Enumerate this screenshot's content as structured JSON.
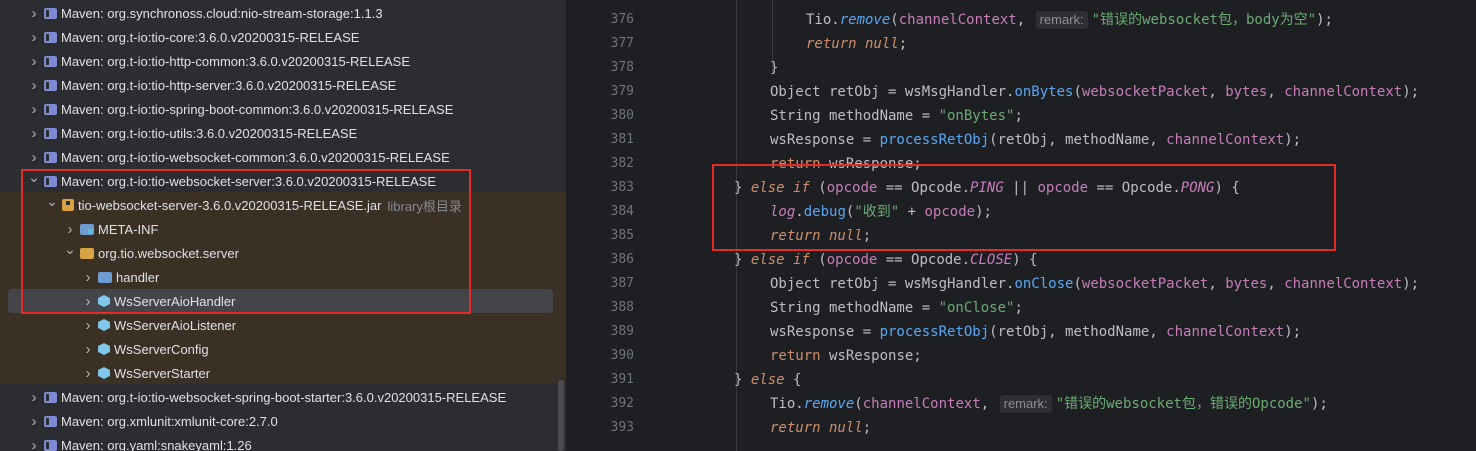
{
  "project_tree": {
    "items": [
      {
        "label": "Maven: org.synchronoss.cloud:nio-stream-storage:1.1.3",
        "level": 0,
        "type": "library",
        "expanded": false
      },
      {
        "label": "Maven: org.t-io:tio-core:3.6.0.v20200315-RELEASE",
        "level": 0,
        "type": "library",
        "expanded": false
      },
      {
        "label": "Maven: org.t-io:tio-http-common:3.6.0.v20200315-RELEASE",
        "level": 0,
        "type": "library",
        "expanded": false
      },
      {
        "label": "Maven: org.t-io:tio-http-server:3.6.0.v20200315-RELEASE",
        "level": 0,
        "type": "library",
        "expanded": false
      },
      {
        "label": "Maven: org.t-io:tio-spring-boot-common:3.6.0.v20200315-RELEASE",
        "level": 0,
        "type": "library",
        "expanded": false
      },
      {
        "label": "Maven: org.t-io:tio-utils:3.6.0.v20200315-RELEASE",
        "level": 0,
        "type": "library",
        "expanded": false
      },
      {
        "label": "Maven: org.t-io:tio-websocket-common:3.6.0.v20200315-RELEASE",
        "level": 0,
        "type": "library",
        "expanded": false
      },
      {
        "label": "Maven: org.t-io:tio-websocket-server:3.6.0.v20200315-RELEASE",
        "level": 0,
        "type": "library",
        "expanded": true
      },
      {
        "label": "tio-websocket-server-3.6.0.v20200315-RELEASE.jar",
        "suffix": "library根目录",
        "level": 1,
        "type": "jar",
        "expanded": true
      },
      {
        "label": "META-INF",
        "level": 2,
        "type": "folder-meta",
        "expanded": false
      },
      {
        "label": "org.tio.websocket.server",
        "level": 2,
        "type": "package",
        "expanded": true
      },
      {
        "label": "handler",
        "level": 3,
        "type": "folder",
        "expanded": false
      },
      {
        "label": "WsServerAioHandler",
        "level": 3,
        "type": "class",
        "expanded": false,
        "selected": true
      },
      {
        "label": "WsServerAioListener",
        "level": 3,
        "type": "class",
        "expanded": false
      },
      {
        "label": "WsServerConfig",
        "level": 3,
        "type": "class",
        "expanded": false
      },
      {
        "label": "WsServerStarter",
        "level": 3,
        "type": "class",
        "expanded": false
      },
      {
        "label": "Maven: org.t-io:tio-websocket-spring-boot-starter:3.6.0.v20200315-RELEASE",
        "level": 0,
        "type": "library",
        "expanded": false
      },
      {
        "label": "Maven: org.xmlunit:xmlunit-core:2.7.0",
        "level": 0,
        "type": "library",
        "expanded": false
      },
      {
        "label": "Maven: org.yaml:snakeyaml:1.26",
        "level": 0,
        "type": "library",
        "expanded": false
      }
    ]
  },
  "editor": {
    "lines": [
      {
        "n": "376",
        "tokens": [
          [
            "typ",
            "Tio."
          ],
          [
            "fni",
            "remove"
          ],
          [
            "typ",
            "("
          ],
          [
            "fld",
            "channelContext"
          ],
          [
            "typ",
            ", "
          ],
          [
            "hint",
            "remark:"
          ],
          [
            "str",
            "\"错误的websocket包，body为空\""
          ],
          [
            "typ",
            ");"
          ]
        ],
        "indent": 3
      },
      {
        "n": "377",
        "tokens": [
          [
            "kwi",
            "return null"
          ],
          [
            "typ",
            ";"
          ]
        ],
        "indent": 3
      },
      {
        "n": "378",
        "tokens": [
          [
            "typ",
            "}"
          ]
        ],
        "indent": 2
      },
      {
        "n": "379",
        "tokens": [
          [
            "typ",
            "Object retObj = wsMsgHandler."
          ],
          [
            "fn",
            "onBytes"
          ],
          [
            "typ",
            "("
          ],
          [
            "fld",
            "websocketPacket"
          ],
          [
            "typ",
            ", "
          ],
          [
            "fld",
            "bytes"
          ],
          [
            "typ",
            ", "
          ],
          [
            "fld",
            "channelContext"
          ],
          [
            "typ",
            ");"
          ]
        ],
        "indent": 2
      },
      {
        "n": "380",
        "tokens": [
          [
            "typ",
            "String methodName = "
          ],
          [
            "str",
            "\"onBytes\""
          ],
          [
            "typ",
            ";"
          ]
        ],
        "indent": 2
      },
      {
        "n": "381",
        "tokens": [
          [
            "typ",
            "wsResponse = "
          ],
          [
            "fn",
            "processRetObj"
          ],
          [
            "typ",
            "(retObj, methodName, "
          ],
          [
            "fld",
            "channelContext"
          ],
          [
            "typ",
            ");"
          ]
        ],
        "indent": 2
      },
      {
        "n": "382",
        "tokens": [
          [
            "kw",
            "return "
          ],
          [
            "typ",
            "wsResponse;"
          ]
        ],
        "indent": 2
      },
      {
        "n": "383",
        "tokens": [
          [
            "typ",
            "} "
          ],
          [
            "kwi",
            "else if"
          ],
          [
            "typ",
            " ("
          ],
          [
            "fld",
            "opcode"
          ],
          [
            "typ",
            " == Opcode."
          ],
          [
            "fldi",
            "PING"
          ],
          [
            "typ",
            " || "
          ],
          [
            "fld",
            "opcode"
          ],
          [
            "typ",
            " == Opcode."
          ],
          [
            "fldi",
            "PONG"
          ],
          [
            "typ",
            ") {"
          ]
        ],
        "indent": 1
      },
      {
        "n": "384",
        "tokens": [
          [
            "fldi",
            "log"
          ],
          [
            "typ",
            "."
          ],
          [
            "fn",
            "debug"
          ],
          [
            "typ",
            "("
          ],
          [
            "str",
            "\"收到\""
          ],
          [
            "typ",
            " + "
          ],
          [
            "fld",
            "opcode"
          ],
          [
            "typ",
            ");"
          ]
        ],
        "indent": 2
      },
      {
        "n": "385",
        "tokens": [
          [
            "kwi",
            "return null"
          ],
          [
            "typ",
            ";"
          ]
        ],
        "indent": 2
      },
      {
        "n": "386",
        "tokens": [
          [
            "typ",
            "} "
          ],
          [
            "kwi",
            "else if"
          ],
          [
            "typ",
            " ("
          ],
          [
            "fld",
            "opcode"
          ],
          [
            "typ",
            " == Opcode."
          ],
          [
            "fldi",
            "CLOSE"
          ],
          [
            "typ",
            ") {"
          ]
        ],
        "indent": 1
      },
      {
        "n": "387",
        "tokens": [
          [
            "typ",
            "Object retObj = wsMsgHandler."
          ],
          [
            "fn",
            "onClose"
          ],
          [
            "typ",
            "("
          ],
          [
            "fld",
            "websocketPacket"
          ],
          [
            "typ",
            ", "
          ],
          [
            "fld",
            "bytes"
          ],
          [
            "typ",
            ", "
          ],
          [
            "fld",
            "channelContext"
          ],
          [
            "typ",
            ");"
          ]
        ],
        "indent": 2
      },
      {
        "n": "388",
        "tokens": [
          [
            "typ",
            "String methodName = "
          ],
          [
            "str",
            "\"onClose\""
          ],
          [
            "typ",
            ";"
          ]
        ],
        "indent": 2
      },
      {
        "n": "389",
        "tokens": [
          [
            "typ",
            "wsResponse = "
          ],
          [
            "fn",
            "processRetObj"
          ],
          [
            "typ",
            "(retObj, methodName, "
          ],
          [
            "fld",
            "channelContext"
          ],
          [
            "typ",
            ");"
          ]
        ],
        "indent": 2
      },
      {
        "n": "390",
        "tokens": [
          [
            "kw",
            "return "
          ],
          [
            "typ",
            "wsResponse;"
          ]
        ],
        "indent": 2
      },
      {
        "n": "391",
        "tokens": [
          [
            "typ",
            "} "
          ],
          [
            "kwi",
            "else"
          ],
          [
            "typ",
            " {"
          ]
        ],
        "indent": 1
      },
      {
        "n": "392",
        "tokens": [
          [
            "typ",
            "Tio."
          ],
          [
            "fni",
            "remove"
          ],
          [
            "typ",
            "("
          ],
          [
            "fld",
            "channelContext"
          ],
          [
            "typ",
            ", "
          ],
          [
            "hint",
            "remark:"
          ],
          [
            "str",
            "\"错误的websocket包，错误的Opcode\""
          ],
          [
            "typ",
            ");"
          ]
        ],
        "indent": 2
      },
      {
        "n": "393",
        "tokens": [
          [
            "kwi",
            "return null"
          ],
          [
            "typ",
            ";"
          ]
        ],
        "indent": 2
      }
    ]
  },
  "colors": {
    "highlight_box": "#e52a2a",
    "selection": "#43454a",
    "jar_bg": "#3a3024"
  }
}
